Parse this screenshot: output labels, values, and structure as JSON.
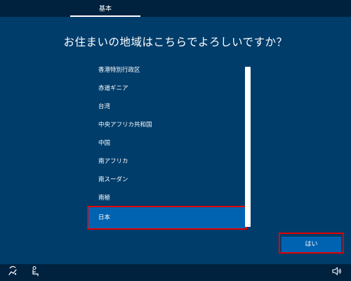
{
  "header": {
    "tab_basic": "基本"
  },
  "page": {
    "question": "お住まいの地域はこちらでよろしいですか？"
  },
  "regions": {
    "items": [
      {
        "label": "香港特別行政区",
        "selected": false
      },
      {
        "label": "赤道ギニア",
        "selected": false
      },
      {
        "label": "台湾",
        "selected": false
      },
      {
        "label": "中央アフリカ共和国",
        "selected": false
      },
      {
        "label": "中国",
        "selected": false
      },
      {
        "label": "南アフリカ",
        "selected": false
      },
      {
        "label": "南スーダン",
        "selected": false
      },
      {
        "label": "南極",
        "selected": false
      },
      {
        "label": "日本",
        "selected": true
      }
    ]
  },
  "actions": {
    "yes_label": "はい"
  },
  "footer": {
    "icons": [
      "ease-of-access-icon",
      "accessibility-narrator-icon",
      "volume-icon"
    ]
  },
  "colors": {
    "background": "#003d6b",
    "bar": "#00223f",
    "accent": "#0063b1",
    "highlight": "#e00000"
  }
}
